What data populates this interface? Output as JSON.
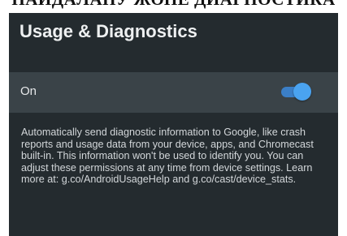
{
  "caption": {
    "text": "НАЙДАЛАНУ ЖӘНЕ ДИАГНОСТИКА"
  },
  "screen": {
    "title": "Usage & Diagnostics",
    "toggle": {
      "label": "On",
      "state": "on",
      "accent_color": "#4aa3f0"
    },
    "description": "Automatically send diagnostic information to Google, like crash reports and usage data from your device, apps, and Chromecast built-in. This information won't be used to identify you. You can adjust these permissions at any time from device settings. Learn more at: g.co/AndroidUsageHelp and g.co/cast/device_stats."
  }
}
